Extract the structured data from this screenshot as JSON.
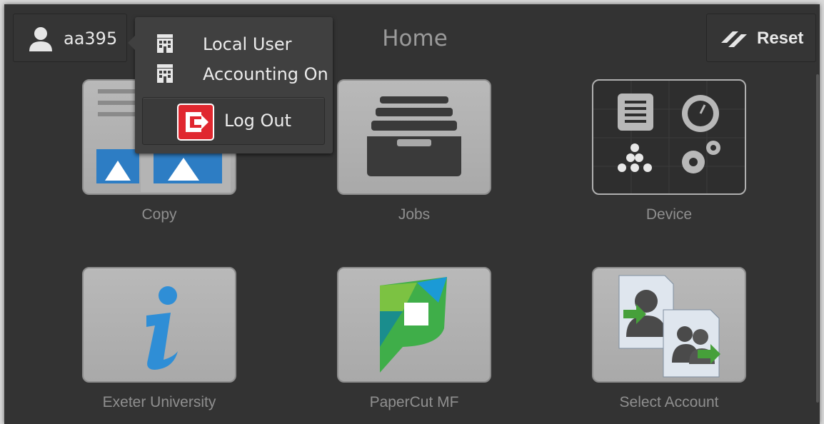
{
  "header": {
    "user": "aa395",
    "title": "Home",
    "reset_label": "Reset"
  },
  "user_menu": {
    "items": [
      {
        "label": "Local User",
        "icon": "building-icon"
      },
      {
        "label": "Accounting On",
        "icon": "building-icon"
      }
    ],
    "logout_label": "Log Out"
  },
  "apps": [
    {
      "label": "Copy",
      "icon": "copy-icon"
    },
    {
      "label": "Jobs",
      "icon": "jobs-tray-icon"
    },
    {
      "label": "Device",
      "icon": "device-icon"
    },
    {
      "label": "Exeter University",
      "icon": "info-icon"
    },
    {
      "label": "PaperCut MF",
      "icon": "papercut-logo-icon"
    },
    {
      "label": "Select Account",
      "icon": "select-account-icon"
    }
  ],
  "colors": {
    "background": "#333333",
    "logout_red": "#e0272f",
    "info_blue": "#2f8ed6"
  }
}
